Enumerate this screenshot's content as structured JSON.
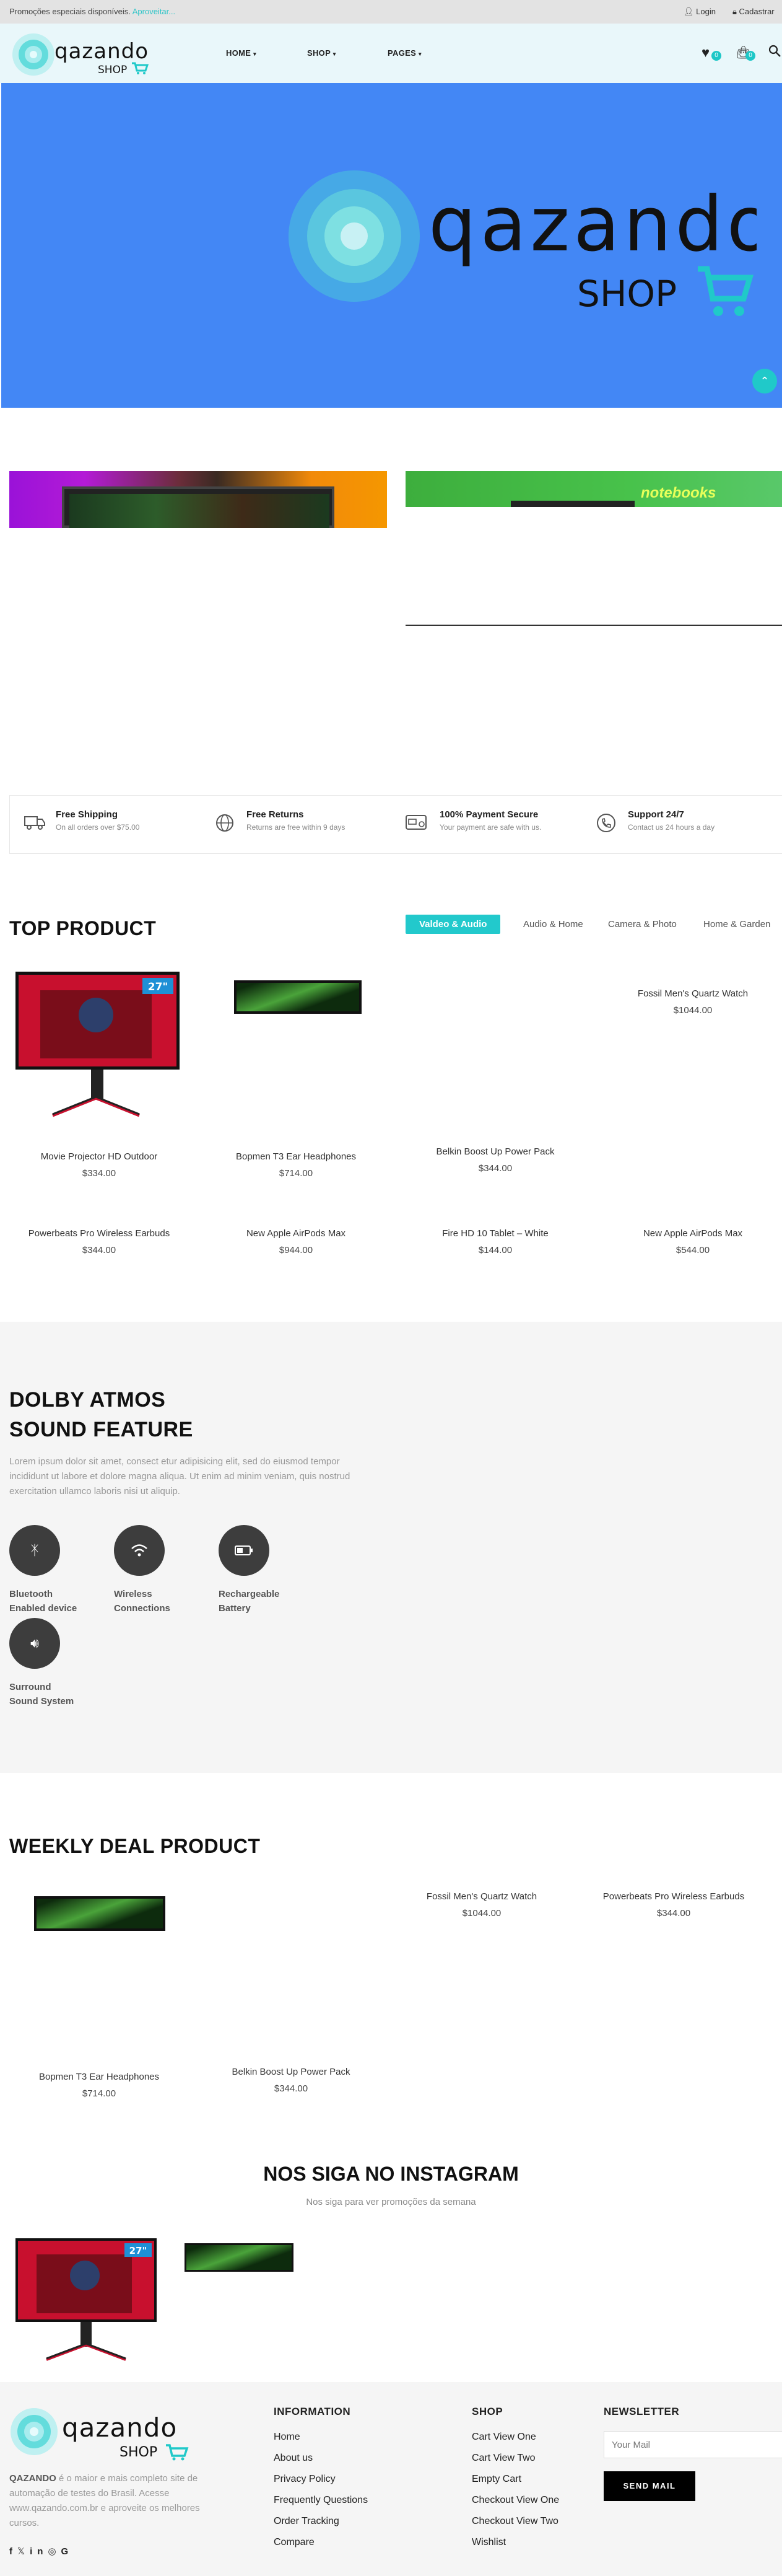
{
  "topbar": {
    "promo_text": "Promoções especiais disponíveis.",
    "promo_link": "Aproveitar...",
    "login": "Login",
    "register": "Cadastrar"
  },
  "brand": {
    "name": "qazando",
    "sub": "SHOP",
    "accent": "#20c9c9"
  },
  "nav": {
    "home": "HOME",
    "shop": "SHOP",
    "pages": "PAGES"
  },
  "header": {
    "wishlist_count": "0",
    "cart_count": "0"
  },
  "features": [
    {
      "title": "Free Shipping",
      "sub": "On all orders over $75.00",
      "icon": "truck-icon"
    },
    {
      "title": "Free Returns",
      "sub": "Returns are free within 9 days",
      "icon": "globe-icon"
    },
    {
      "title": "100% Payment Secure",
      "sub": "Your payment are safe with us.",
      "icon": "payment-icon"
    },
    {
      "title": "Support 24/7",
      "sub": "Contact us 24 hours a day",
      "icon": "phone-icon"
    }
  ],
  "top_product": {
    "title": "TOP PRODUCT",
    "tabs": [
      "Valdeo & Audio",
      "Audio & Home",
      "Camera & Photo",
      "Home & Garden"
    ],
    "items": [
      {
        "name": "Movie Projector HD Outdoor",
        "price": "$334.00"
      },
      {
        "name": "Bopmen T3 Ear Headphones",
        "price": "$714.00"
      },
      {
        "name": "Belkin Boost Up Power Pack",
        "price": "$344.00"
      },
      {
        "name": "Fossil Men's Quartz Watch",
        "price": "$1044.00"
      },
      {
        "name": "Powerbeats Pro Wireless Earbuds",
        "price": "$344.00"
      },
      {
        "name": "New Apple AirPods Max",
        "price": "$944.00"
      },
      {
        "name": "Fire HD 10 Tablet – White",
        "price": "$144.00"
      },
      {
        "name": "New Apple AirPods Max",
        "price": "$544.00"
      }
    ],
    "monitor_badge": "27\""
  },
  "dolby": {
    "title_line1": "DOLBY ATMOS",
    "title_line2": "SOUND FEATURE",
    "text": "Lorem ipsum dolor sit amet, consect etur adipisicing elit, sed do eiusmod tempor incididunt ut labore et dolore magna aliqua. Ut enim ad minim veniam, quis nostrud exercitation ullamco laboris nisi ut aliquip.",
    "features": [
      {
        "l1": "Bluetooth",
        "l2": "Enabled device",
        "icon": "bluetooth-icon"
      },
      {
        "l1": "Wireless",
        "l2": "Connections",
        "icon": "wifi-icon"
      },
      {
        "l1": "Rechargeable",
        "l2": "Battery",
        "icon": "battery-icon"
      },
      {
        "l1": "Surround",
        "l2": "Sound System",
        "icon": "speaker-icon"
      }
    ]
  },
  "weekly": {
    "title": "WEEKLY DEAL PRODUCT",
    "items": [
      {
        "name": "Fossil Men's Quartz Watch",
        "price": "$1044.00"
      },
      {
        "name": "Powerbeats Pro Wireless Earbuds",
        "price": "$344.00"
      },
      {
        "name": "Bopmen T3 Ear Headphones",
        "price": "$714.00"
      },
      {
        "name": "Belkin Boost Up Power Pack",
        "price": "$344.00"
      }
    ]
  },
  "instagram": {
    "title": "NOS SIGA NO INSTAGRAM",
    "sub": "Nos siga para ver promoções da semana"
  },
  "footer": {
    "about_strong": "QAZANDO",
    "about_text": " é o maior e mais completo site de automação de testes do Brasil. Acesse www.qazando.com.br e aproveite os melhores cursos.",
    "information": {
      "title": "INFORMATION",
      "links": [
        "Home",
        "About us",
        "Privacy Policy",
        "Frequently Questions",
        "Order Tracking",
        "Compare"
      ]
    },
    "shop": {
      "title": "SHOP",
      "links": [
        "Cart View One",
        "Cart View Two",
        "Empty Cart",
        "Checkout View One",
        "Checkout View Two",
        "Wishlist"
      ]
    },
    "newsletter": {
      "title": "NEWSLETTER",
      "placeholder": "Your Mail",
      "button": "SEND MAIL"
    }
  }
}
